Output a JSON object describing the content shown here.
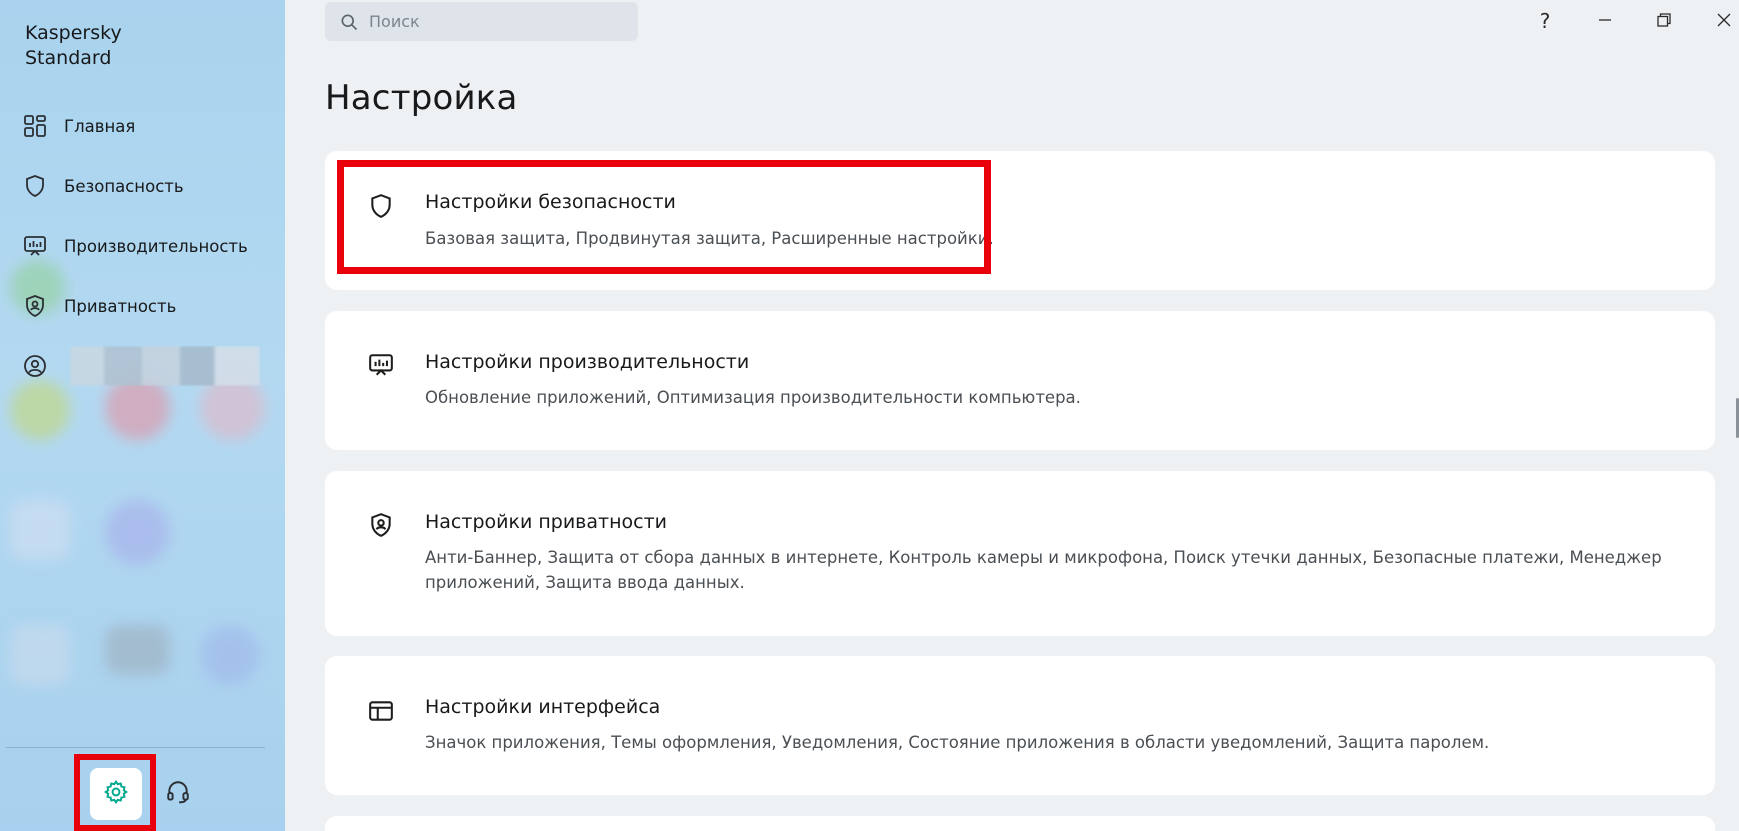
{
  "app": {
    "title_line1": "Kaspersky",
    "title_line2": "Standard"
  },
  "sidebar": {
    "items": [
      {
        "label": "Главная",
        "icon": "dashboard-icon"
      },
      {
        "label": "Безопасность",
        "icon": "shield-icon"
      },
      {
        "label": "Производительность",
        "icon": "monitor-icon"
      },
      {
        "label": "Приватность",
        "icon": "privacy-shield-icon"
      },
      {
        "label": "",
        "icon": "user-icon"
      }
    ],
    "tools": [
      {
        "icon": "gear-icon",
        "active": true
      },
      {
        "icon": "headset-icon",
        "active": false
      }
    ]
  },
  "search": {
    "placeholder": "Поиск"
  },
  "window_controls": {
    "help": "?",
    "minimize": "minimize-icon",
    "maximize": "restore-icon",
    "close": "close-icon"
  },
  "main": {
    "title": "Настройка",
    "cards": [
      {
        "title": "Настройки безопасности",
        "description": "Базовая защита, Продвинутая защита, Расширенные настройки.",
        "icon": "shield-icon"
      },
      {
        "title": "Настройки производительности",
        "description": "Обновление приложений, Оптимизация производительности компьютера.",
        "icon": "monitor-icon"
      },
      {
        "title": "Настройки приватности",
        "description": "Анти-Баннер, Защита от сбора данных в интернете, Контроль камеры и микрофона, Поиск утечки данных, Безопасные платежи, Менеджер приложений, Защита ввода данных.",
        "icon": "privacy-shield-icon"
      },
      {
        "title": "Настройки интерфейса",
        "description": "Значок приложения, Темы оформления, Уведомления, Состояние приложения в области уведомлений, Защита паролем.",
        "icon": "layout-icon"
      }
    ]
  },
  "colors": {
    "highlight": "#e8000b",
    "accent": "#00a88e",
    "sidebar_bg": "#a9d3ee",
    "card_bg": "#ffffff"
  }
}
